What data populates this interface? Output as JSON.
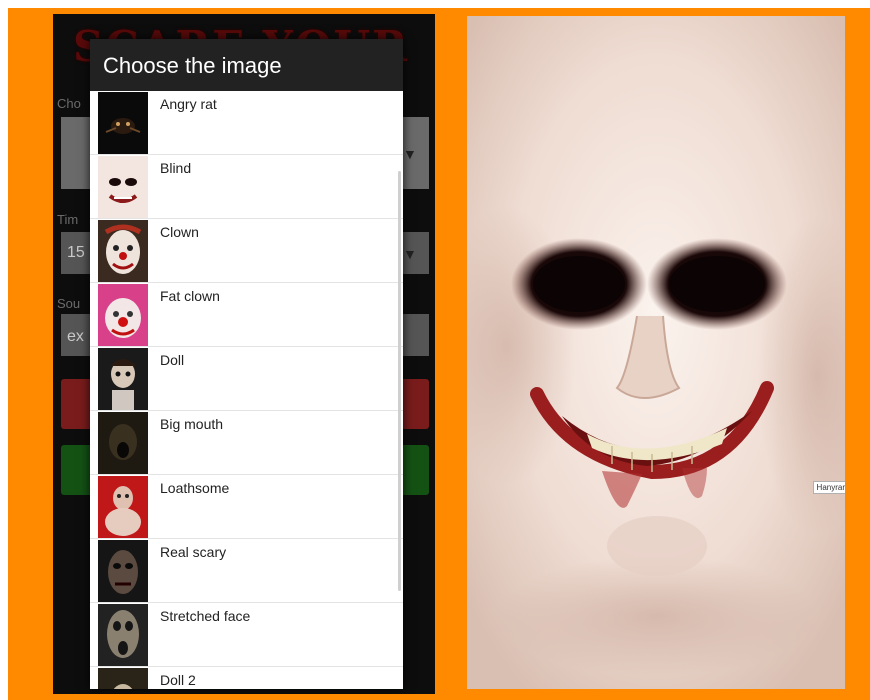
{
  "app": {
    "banner_text": "SCARE YOUR FRIEND",
    "bg_labels": [
      "Cho",
      "Tim",
      "Sou"
    ],
    "bg_values": [
      "15",
      "ex"
    ]
  },
  "dialog": {
    "title": "Choose the image",
    "items": [
      {
        "label": "Angry rat",
        "icon": "angry-rat-thumbnail"
      },
      {
        "label": "Blind",
        "icon": "blind-face-thumbnail"
      },
      {
        "label": "Clown",
        "icon": "clown-thumbnail"
      },
      {
        "label": "Fat clown",
        "icon": "fat-clown-thumbnail"
      },
      {
        "label": "Doll",
        "icon": "doll-thumbnail"
      },
      {
        "label": "Big mouth",
        "icon": "big-mouth-thumbnail"
      },
      {
        "label": "Loathsome",
        "icon": "loathsome-thumbnail"
      },
      {
        "label": "Real scary",
        "icon": "real-scary-thumbnail"
      },
      {
        "label": "Stretched face",
        "icon": "stretched-face-thumbnail"
      },
      {
        "label": "Doll 2",
        "icon": "doll-2-thumbnail"
      }
    ]
  },
  "preview": {
    "watermark": "Hanyrar",
    "colors": {
      "background": "#ff8a00",
      "skin": "#f1e2da",
      "eyes": "#1b0b0b",
      "lips": "#8c1a1a"
    }
  }
}
